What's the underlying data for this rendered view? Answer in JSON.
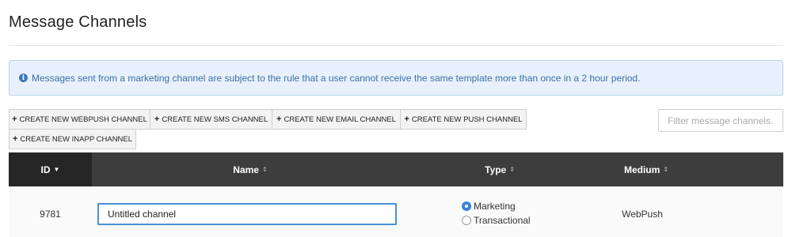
{
  "page": {
    "title": "Message Channels"
  },
  "info": {
    "icon": "info-icon",
    "text": "Messages sent from a marketing channel are subject to the rule that a user cannot receive the same template more than once in a 2 hour period."
  },
  "create_buttons": [
    {
      "label": "CREATE NEW WEBPUSH CHANNEL"
    },
    {
      "label": "CREATE NEW SMS CHANNEL"
    },
    {
      "label": "CREATE NEW EMAIL CHANNEL"
    },
    {
      "label": "CREATE NEW PUSH CHANNEL"
    },
    {
      "label": "CREATE NEW INAPP CHANNEL"
    }
  ],
  "filter": {
    "placeholder": "Filter message channels..."
  },
  "table": {
    "columns": {
      "id": "ID",
      "name": "Name",
      "type": "Type",
      "medium": "Medium"
    },
    "rows": [
      {
        "id": "9781",
        "name": "Untitled channel",
        "type_options": [
          "Marketing",
          "Transactional"
        ],
        "type_selected": "Marketing",
        "medium": "WebPush"
      }
    ]
  }
}
